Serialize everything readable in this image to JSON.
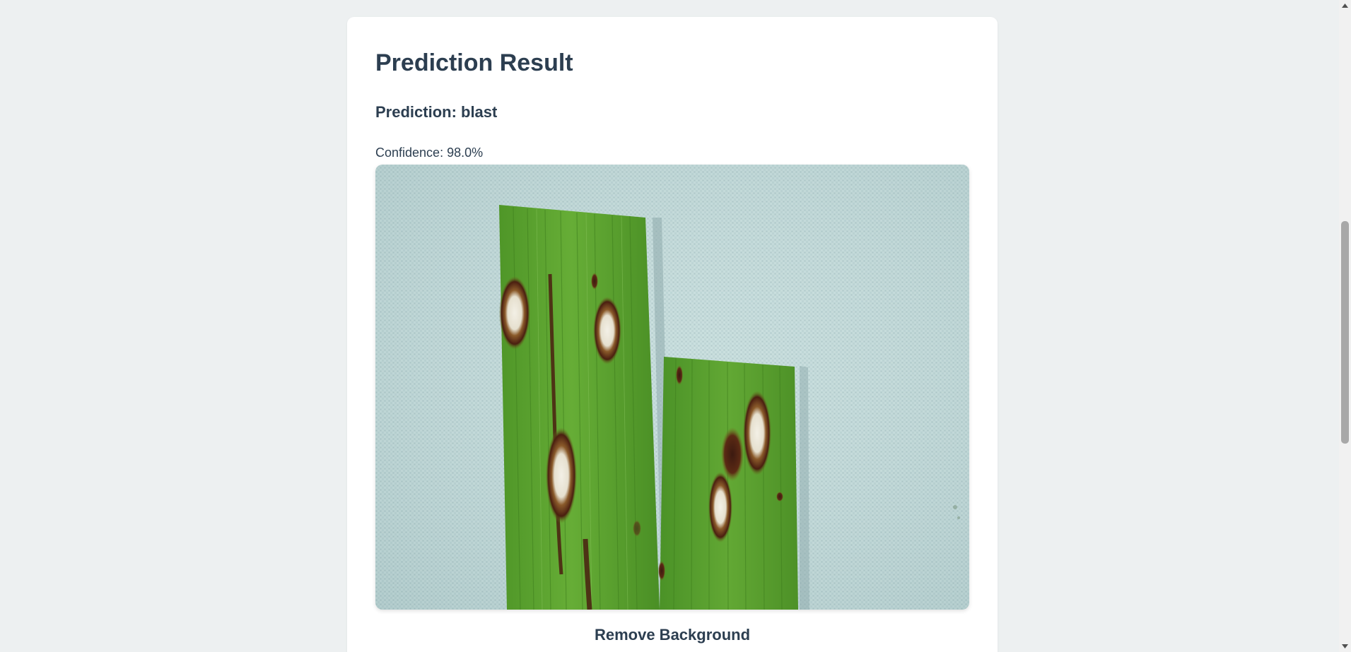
{
  "result": {
    "title": "Prediction Result",
    "prediction_text": "Prediction: blast",
    "confidence_text": "Confidence: 98.0%"
  },
  "actions": {
    "remove_background_label": "Remove Background"
  },
  "image": {
    "subject": "rice-leaf-blast-lesions",
    "background_color": "#b9d3d3",
    "leaf_color": "#5a9e2e"
  },
  "scrollbar": {
    "thumb_position_fraction": 0.34
  }
}
